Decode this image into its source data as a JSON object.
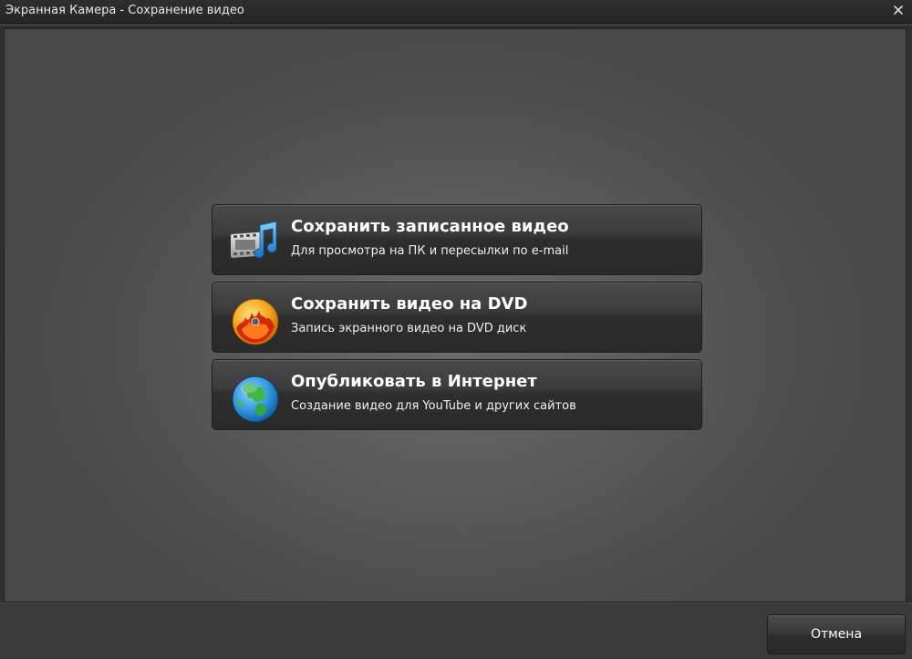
{
  "window": {
    "title": "Экранная Камера - Сохранение видео",
    "close_icon": "close-icon"
  },
  "options": [
    {
      "id": "save-recorded",
      "icon": "film-music-icon",
      "title": "Сохранить записанное видео",
      "description": "Для просмотра на ПК и пересылки по e-mail"
    },
    {
      "id": "save-dvd",
      "icon": "dvd-burn-icon",
      "title": "Сохранить видео на DVD",
      "description": "Запись экранного видео на DVD диск"
    },
    {
      "id": "publish-internet",
      "icon": "globe-icon",
      "title": "Опубликовать в Интернет",
      "description": "Создание видео для YouTube и других сайтов"
    }
  ],
  "footer": {
    "cancel_label": "Отмена"
  },
  "colors": {
    "background": "#303030",
    "button_text": "#ffffff"
  }
}
